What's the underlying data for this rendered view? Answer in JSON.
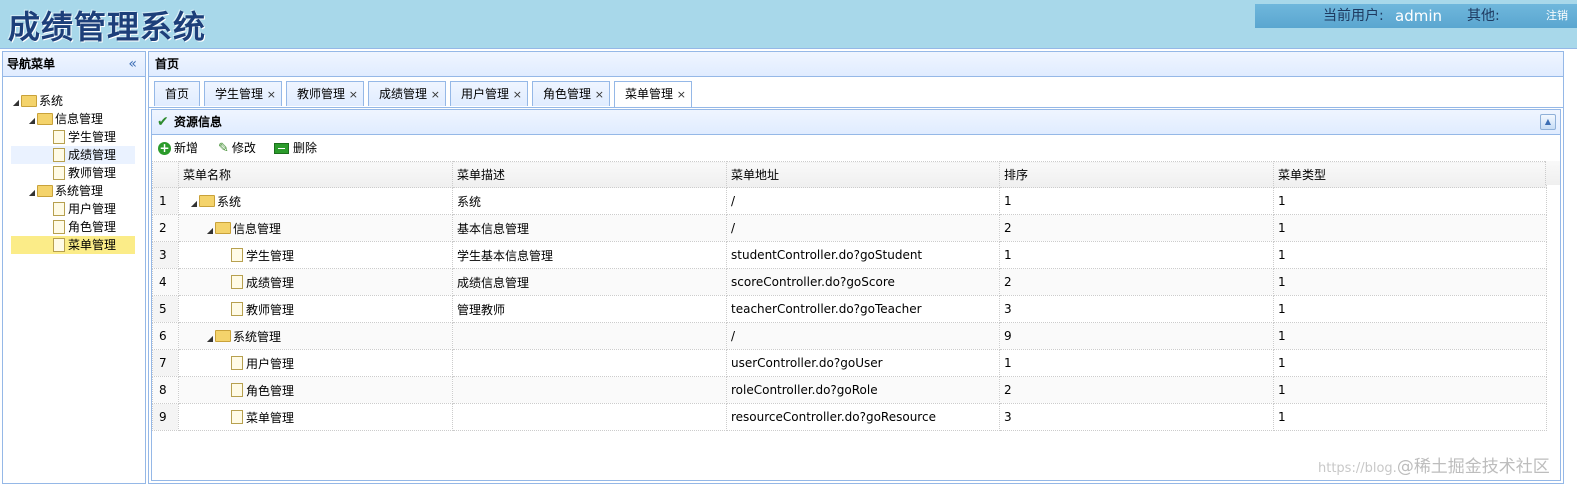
{
  "header": {
    "title": "成绩管理系统",
    "user_label": "当前用户:",
    "username": "admin",
    "other_label": "其他:",
    "logout": "注销"
  },
  "nav": {
    "title": "导航菜单",
    "collapse_icon": "double-chevron-left-icon",
    "tree": [
      {
        "label": "系统",
        "type": "folder",
        "level": 0
      },
      {
        "label": "信息管理",
        "type": "folder",
        "level": 1
      },
      {
        "label": "学生管理",
        "type": "file",
        "level": 2
      },
      {
        "label": "成绩管理",
        "type": "file",
        "level": 2
      },
      {
        "label": "教师管理",
        "type": "file",
        "level": 2
      },
      {
        "label": "系统管理",
        "type": "folder",
        "level": 1
      },
      {
        "label": "用户管理",
        "type": "file",
        "level": 2
      },
      {
        "label": "角色管理",
        "type": "file",
        "level": 2
      },
      {
        "label": "菜单管理",
        "type": "file",
        "level": 2,
        "selected": true
      }
    ]
  },
  "main": {
    "breadcrumb": "首页",
    "tabs": [
      {
        "label": "首页",
        "closable": false
      },
      {
        "label": "学生管理",
        "closable": true
      },
      {
        "label": "教师管理",
        "closable": true
      },
      {
        "label": "成绩管理",
        "closable": true
      },
      {
        "label": "用户管理",
        "closable": true
      },
      {
        "label": "角色管理",
        "closable": true
      },
      {
        "label": "菜单管理",
        "closable": true,
        "active": true
      }
    ],
    "close_glyph": "×",
    "panel_title": "资源信息",
    "toolbar": {
      "add": "新增",
      "edit": "修改",
      "delete": "删除"
    },
    "columns": [
      "菜单名称",
      "菜单描述",
      "菜单地址",
      "排序",
      "菜单类型"
    ],
    "rows": [
      {
        "no": "1",
        "name": "系统",
        "level": 0,
        "node": "folder",
        "desc": "系统",
        "url": "/",
        "order": "1",
        "type": "1"
      },
      {
        "no": "2",
        "name": "信息管理",
        "level": 1,
        "node": "folder",
        "desc": "基本信息管理",
        "url": "/",
        "order": "2",
        "type": "1"
      },
      {
        "no": "3",
        "name": "学生管理",
        "level": 2,
        "node": "file",
        "desc": "学生基本信息管理",
        "url": "studentController.do?goStudent",
        "order": "1",
        "type": "1"
      },
      {
        "no": "4",
        "name": "成绩管理",
        "level": 2,
        "node": "file",
        "desc": "成绩信息管理",
        "url": "scoreController.do?goScore",
        "order": "2",
        "type": "1"
      },
      {
        "no": "5",
        "name": "教师管理",
        "level": 2,
        "node": "file",
        "desc": "管理教师",
        "url": "teacherController.do?goTeacher",
        "order": "3",
        "type": "1"
      },
      {
        "no": "6",
        "name": "系统管理",
        "level": 1,
        "node": "folder",
        "desc": "",
        "url": "/",
        "order": "9",
        "type": "1"
      },
      {
        "no": "7",
        "name": "用户管理",
        "level": 2,
        "node": "file",
        "desc": "",
        "url": "userController.do?goUser",
        "order": "1",
        "type": "1"
      },
      {
        "no": "8",
        "name": "角色管理",
        "level": 2,
        "node": "file",
        "desc": "",
        "url": "roleController.do?goRole",
        "order": "2",
        "type": "1"
      },
      {
        "no": "9",
        "name": "菜单管理",
        "level": 2,
        "node": "file",
        "desc": "",
        "url": "resourceController.do?goResource",
        "order": "3",
        "type": "1"
      }
    ]
  },
  "watermark": {
    "prefix": "https://blog.",
    "brand": "@稀土掘金技术社区"
  },
  "colors": {
    "header_bg": "#a8d8ea",
    "border": "#95b8e7",
    "selected": "#fbec88",
    "accent_green": "#2b9b2b"
  }
}
